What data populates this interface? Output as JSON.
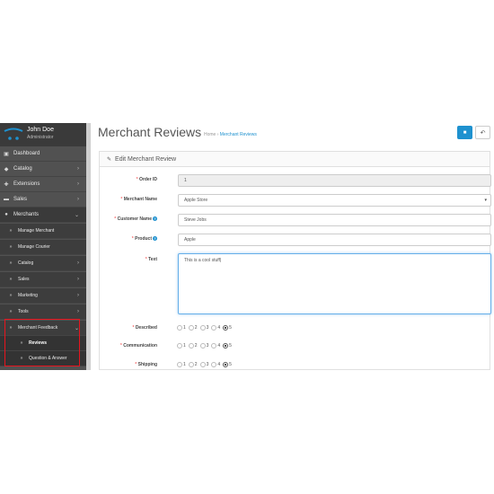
{
  "user": {
    "name": "John Doe",
    "role": "Administrator"
  },
  "nav": {
    "top": [
      {
        "label": "Dashboard",
        "icon": "dashboard-icon",
        "glyph": "▣"
      },
      {
        "label": "Catalog",
        "icon": "tag-icon",
        "glyph": "◆",
        "chevron": "›"
      },
      {
        "label": "Extensions",
        "icon": "puzzle-icon",
        "glyph": "✚",
        "chevron": "›"
      },
      {
        "label": "Sales",
        "icon": "cart-icon",
        "glyph": "▬",
        "chevron": "›"
      },
      {
        "label": "Merchants",
        "icon": "users-icon",
        "glyph": "●",
        "chevron": "⌄"
      }
    ],
    "merchant_sub": [
      {
        "label": "Manage Merchant"
      },
      {
        "label": "Manage Courier"
      },
      {
        "label": "Catalog",
        "chevron": "›"
      },
      {
        "label": "Sales",
        "chevron": "›"
      },
      {
        "label": "Marketing",
        "chevron": "›"
      },
      {
        "label": "Tools",
        "chevron": "›"
      },
      {
        "label": "Merchant Feedback",
        "chevron": "⌄"
      }
    ],
    "feedback_sub": [
      {
        "label": "Reviews"
      },
      {
        "label": "Question & Answer"
      }
    ]
  },
  "page": {
    "title": "Merchant Reviews",
    "breadcrumb": {
      "home": "Home",
      "separator": "›",
      "current": "Merchant Reviews"
    }
  },
  "panel": {
    "title": "Edit Merchant Review"
  },
  "form": {
    "order_id": {
      "label": "Order ID",
      "value": "1"
    },
    "merchant_name": {
      "label": "Merchant Name",
      "value": "Apple Store"
    },
    "customer_name": {
      "label": "Customer Name",
      "value": "Steve Jobs"
    },
    "product": {
      "label": "Product",
      "value": "Apple"
    },
    "text": {
      "label": "Text",
      "value": "This is a cool stuff"
    },
    "ratings": [
      {
        "label": "Described",
        "options": [
          "1",
          "2",
          "3",
          "4",
          "5"
        ],
        "selected": 5
      },
      {
        "label": "Communication",
        "options": [
          "1",
          "2",
          "3",
          "4",
          "5"
        ],
        "selected": 5
      },
      {
        "label": "Shipping",
        "options": [
          "1",
          "2",
          "3",
          "4",
          "5"
        ],
        "selected": 5
      }
    ]
  },
  "colors": {
    "accent": "#1e91cf",
    "sidebar": "#515151",
    "required": "#f56b6b",
    "highlight": "#e8141e"
  }
}
